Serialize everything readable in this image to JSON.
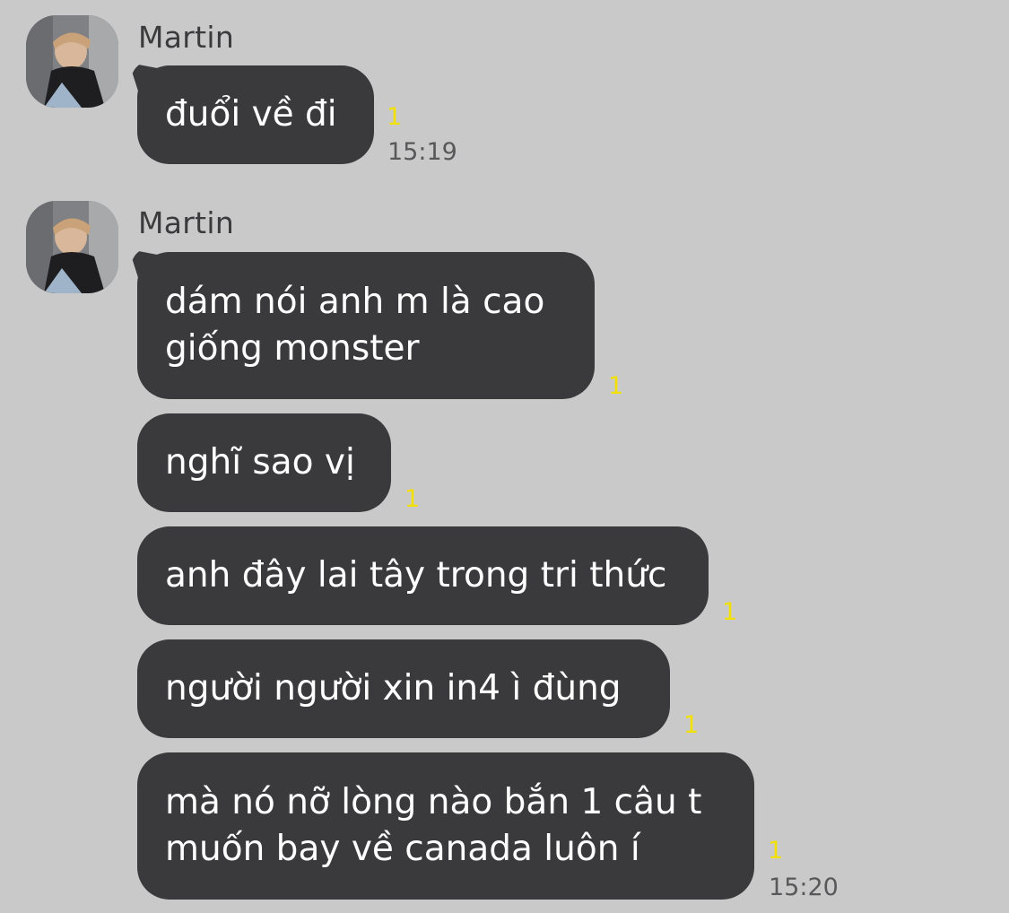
{
  "chat": {
    "groups": [
      {
        "sender": "Martin",
        "messages": [
          {
            "lines": [
              "đuổi về đi"
            ],
            "read_count": "1",
            "time": "15:19"
          }
        ]
      },
      {
        "sender": "Martin",
        "messages": [
          {
            "lines": [
              "dám nói anh m là cao",
              "giống monster"
            ],
            "read_count": "1"
          },
          {
            "lines": [
              "nghĩ sao vị"
            ],
            "read_count": "1"
          },
          {
            "lines": [
              "anh đây lai tây trong tri thức"
            ],
            "read_count": "1"
          },
          {
            "lines": [
              "người người xin in4 ì đùng"
            ],
            "read_count": "1"
          },
          {
            "lines": [
              "mà nó nỡ lòng nào bắn 1 câu t",
              "muốn bay về canada luôn í"
            ],
            "read_count": "1",
            "time": "15:20"
          }
        ]
      }
    ]
  },
  "colors": {
    "background": "#c9c9c9",
    "bubble": "#3a3a3c",
    "bubble_text": "#ffffff",
    "read_count": "#f2e100",
    "meta_text": "#58585a"
  }
}
